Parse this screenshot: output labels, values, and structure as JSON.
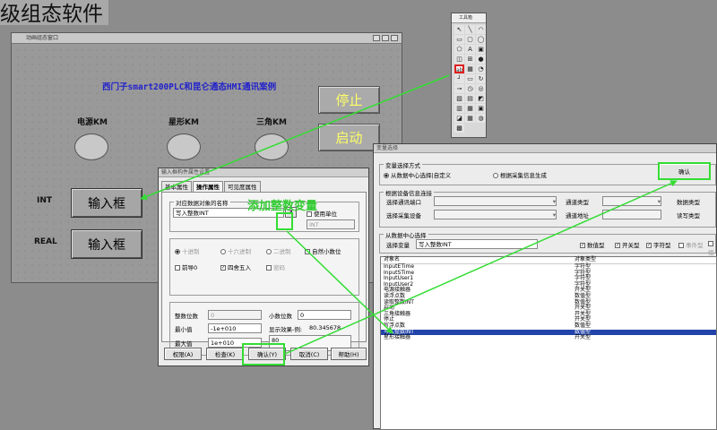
{
  "page": {
    "heading": "级组态软件"
  },
  "design_window": {
    "title": "动画组态窗口",
    "caption": "西门子smart200PLC和昆仑通态HMI通讯案例",
    "lamp_labels": [
      "电源KM",
      "星形KM",
      "三角KM"
    ],
    "stop_button": "停止",
    "start_button": "启动",
    "int_label": "INT",
    "real_label": "REAL",
    "input_box_1": "输入框",
    "input_box_2": "输入框"
  },
  "toolbox": {
    "title": "工具箱"
  },
  "annotation": "添加整数变量",
  "input_dialog": {
    "title": "输入框构件属性设置",
    "tabs": [
      "基本属性",
      "操作属性",
      "可见度属性"
    ],
    "group_label": "对应数据对象的名称",
    "object_value": "写入整数INT",
    "question_button": "?",
    "use_unit_label": "使用单位",
    "unit_value": "INT",
    "radix_options": [
      "十进制",
      "十六进制",
      "二进制"
    ],
    "natural_decimal_label": "自然小数位",
    "leading_zero_label": "前导0",
    "round_label": "四舍五入",
    "password_label": "密码",
    "int_digits_label": "整数位数",
    "int_digits_value": "0",
    "decimal_digits_label": "小数位数",
    "decimal_digits_value": "0",
    "min_label": "最小值",
    "min_value": "-1e+010",
    "preview_label": "显示效果-例:",
    "preview_value": "80.345678",
    "max_label": "最大值",
    "max_value": "1e+010",
    "preview_box": "80",
    "buttons": [
      "权限(A)",
      "检查(K)",
      "确认(Y)",
      "取消(C)",
      "帮助(H)"
    ]
  },
  "var_dialog": {
    "title": "变量选择",
    "mode_group": "变量选择方式",
    "mode_options": [
      "从数据中心选择|自定义",
      "根据采集信息生成"
    ],
    "confirm_button": "确认",
    "device_group": "根据设备信息连接",
    "channel_labels": [
      "选择通讯端口",
      "选择采集设备"
    ],
    "channel_type_labels": [
      "通道类型",
      "通道地址"
    ],
    "data_type_labels": [
      "数据类型",
      "读写类型"
    ],
    "data_center_group": "从数据中心选择",
    "select_var_label": "选择变量",
    "select_var_value": "写入整数INT",
    "type_filters": [
      "数值型",
      "开关型",
      "字符型",
      "事件型",
      "组"
    ],
    "columns": [
      "对象名",
      "对象类型"
    ],
    "rows": [
      {
        "name": "InputETime",
        "type": "字符型"
      },
      {
        "name": "InputSTime",
        "type": "字符型"
      },
      {
        "name": "InputUser1",
        "type": "字符型"
      },
      {
        "name": "InputUser2",
        "type": "字符型"
      },
      {
        "name": "电源接触器",
        "type": "开关型"
      },
      {
        "name": "读浮点数",
        "type": "数值型"
      },
      {
        "name": "读取整数INT",
        "type": "数值型"
      },
      {
        "name": "启动",
        "type": "开关型"
      },
      {
        "name": "三角接触器",
        "type": "开关型"
      },
      {
        "name": "停止",
        "type": "开关型"
      },
      {
        "name": "写浮点数",
        "type": "数值型"
      },
      {
        "name": "写入整数INT",
        "type": "数值型"
      },
      {
        "name": "星形接触器",
        "type": "开关型"
      }
    ],
    "selected_index": 11
  }
}
